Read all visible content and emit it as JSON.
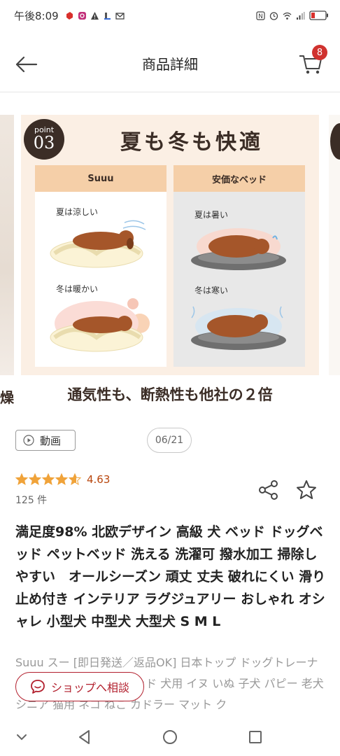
{
  "status_bar": {
    "time": "午後8:09",
    "icons": [
      "app-notification-icon",
      "instagram-icon",
      "warning-icon",
      "upload-icon",
      "mail-icon",
      "nfc-icon",
      "alarm-icon",
      "wifi-icon",
      "signal-icon",
      "battery-low-icon"
    ]
  },
  "header": {
    "title": "商品詳細",
    "cart_count": "8"
  },
  "carousel": {
    "prev_slide_text": "燥",
    "slide": {
      "point_word": "point",
      "point_number": "03",
      "title": "夏も冬も快適",
      "left_panel": {
        "heading": "Suuu",
        "summer_label": "夏は涼しい",
        "winter_label": "冬は暖かい"
      },
      "right_panel": {
        "heading": "安価なベッド",
        "summer_label": "夏は暑い",
        "winter_label": "冬は寒い"
      },
      "caption": "通気性も、断熱性も他社の２倍"
    }
  },
  "media": {
    "video_label": "動画",
    "page_counter": "06/21"
  },
  "rating": {
    "value": "4.63",
    "stars_filled": 4.63,
    "review_count": "125 件"
  },
  "product": {
    "title": "満足度98% 北欧デザイン 高級 犬 ベッド ドッグベッド ペットベッド 洗える 洗濯可 撥水加工 掃除しやすい　オールシーズン 頑丈 丈夫 破れにくい 滑り止め付き インテリア ラグジュアリー おしゃれ オシャレ 小型犬 中型犬 大型犬 S M L",
    "description": "Suuu スー [即日発送／返品OK] 日本トップ ドッグトレーナー監修 ペット用 目線ベッド 犬用 イヌ いぬ 子犬 パピー 老犬 シニア 猫用 ネコ ねこ カドラー マット ク"
  },
  "consult_button": {
    "label": "ショップへ相談"
  },
  "colors": {
    "brand_red": "#b21f2d",
    "badge_red": "#d0322f",
    "star_orange": "#f0a33a",
    "rating_text": "#b8460d",
    "slide_brown": "#3b2d26"
  }
}
